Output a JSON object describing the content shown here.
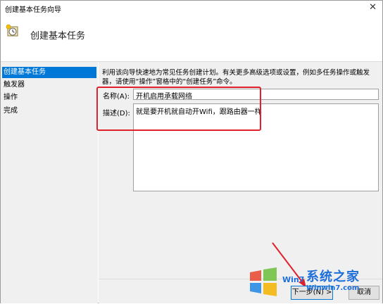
{
  "window": {
    "title": "创建基本任务向导",
    "close_glyph": "✕"
  },
  "header": {
    "title": "创建基本任务",
    "icon": "task-scheduler-icon"
  },
  "sidebar": {
    "items": [
      {
        "label": "创建基本任务",
        "active": true
      },
      {
        "label": "触发器",
        "active": false
      },
      {
        "label": "操作",
        "active": false
      },
      {
        "label": "完成",
        "active": false
      }
    ]
  },
  "main": {
    "description": "利用该向导快速地为常见任务创建计划。有关更多高级选项或设置，例如多任务操作或触发器，请使用“操作”窗格中的“创建任务”命令。",
    "name_label": "名称(A):",
    "name_value": "开机启用承载网络",
    "desc_label": "描述(D):",
    "desc_value": "就是要开机就自动开Wifi，跟路由器一样"
  },
  "buttons": {
    "next": "下一步(N) >",
    "cancel": "取消"
  },
  "watermark": {
    "brand": "系统之家",
    "url": "Winwin7.com",
    "prefix": "Win7"
  },
  "colors": {
    "accent": "#0078d7",
    "highlight_box": "#e0202a"
  }
}
